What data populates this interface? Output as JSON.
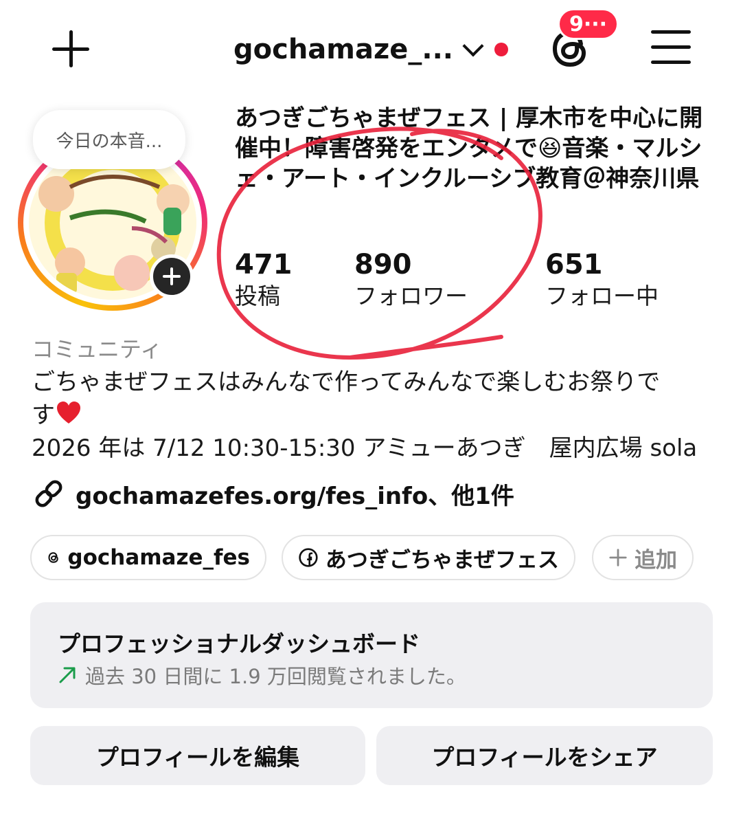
{
  "header": {
    "username": "gochamaze_...",
    "notification_count": "9···",
    "colors": {
      "badge": "#ff2a48",
      "dot": "#ee1d3c"
    }
  },
  "profile": {
    "note": "今日の本音...",
    "full_name": "あつぎごちゃまぜフェス | 厚木市を中心に開催中！障害啓発をエンタメで😆音楽・マルシェ・アート・インクルーシブ教育＠神奈川県",
    "stats": [
      {
        "value": "471",
        "label": "投稿"
      },
      {
        "value": "890",
        "label": "フォロワー"
      },
      {
        "value": "651",
        "label": "フォロー中"
      }
    ],
    "category": "コミュニティ",
    "bio_line1": "ごちゃまぜフェスはみんなで作ってみんなで楽しむお祭りで",
    "bio_line2": "す",
    "bio_line3": "2026 年は 7/12 10:30-15:30 アミューあつぎ　屋内広場 sola",
    "link": "gochamazefes.org/fes_info、他1件"
  },
  "chips": {
    "threads": "gochamaze_fes",
    "facebook": "あつぎごちゃまぜフェス",
    "add": "追加"
  },
  "dashboard": {
    "title": "プロフェッショナルダッシュボード",
    "subtitle": "過去 30 日間に 1.9 万回閲覧されました。",
    "trend_color": "#1a9c4a"
  },
  "buttons": {
    "edit_profile": "プロフィールを編集",
    "share_profile": "プロフィールをシェア"
  },
  "annotation": {
    "color": "#e8203a"
  }
}
